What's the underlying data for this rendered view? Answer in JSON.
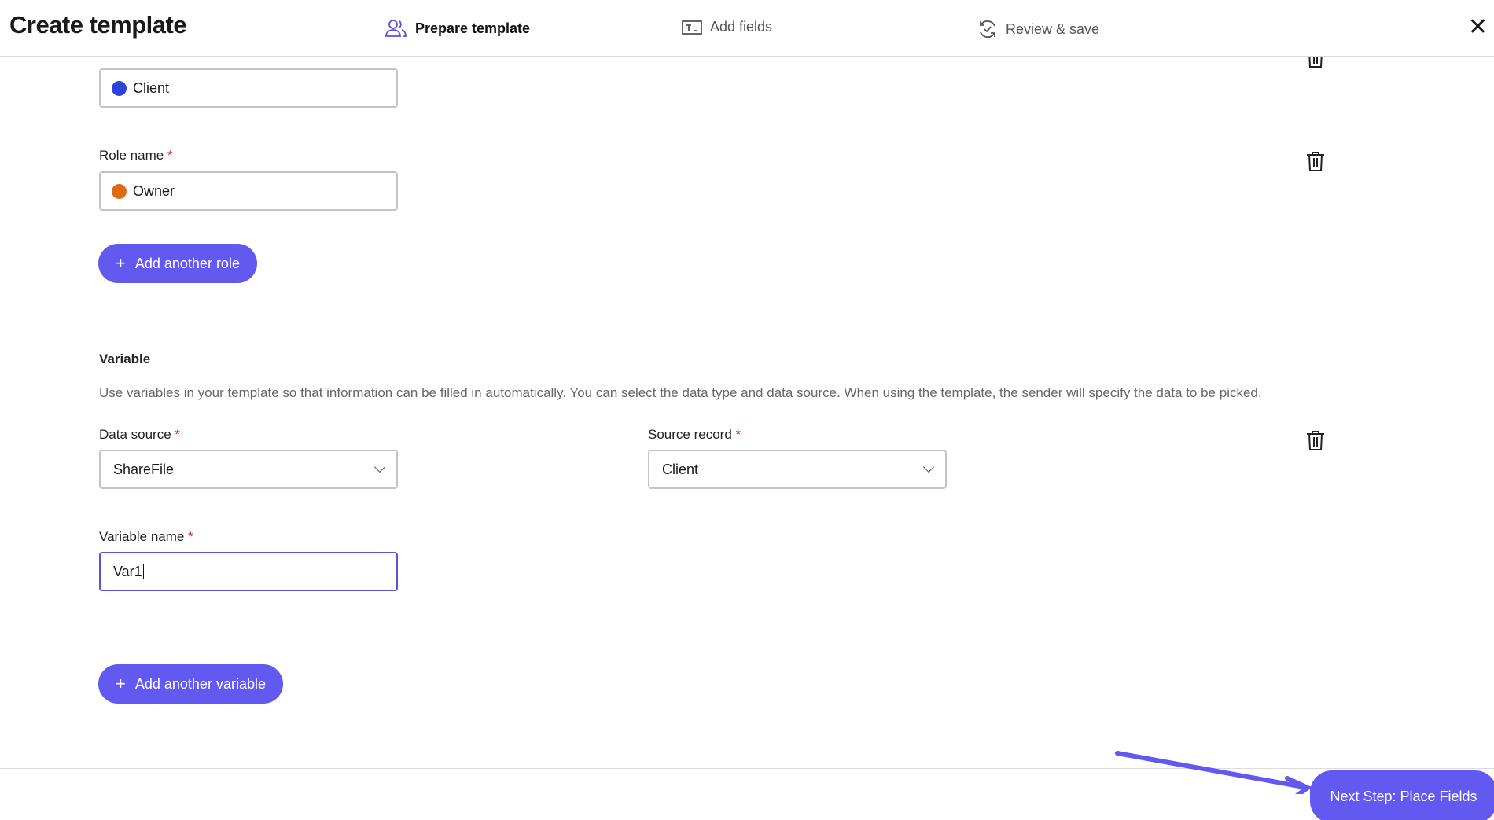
{
  "header": {
    "title": "Create template",
    "close_icon": "close-icon",
    "steps": [
      {
        "label": "Prepare template",
        "icon": "users-icon",
        "active": true
      },
      {
        "label": "Add fields",
        "icon": "text-field-icon",
        "active": false
      },
      {
        "label": "Review & save",
        "icon": "refresh-check-icon",
        "active": false
      }
    ]
  },
  "roles": {
    "items": [
      {
        "label": "Role name",
        "value": "Client",
        "color": "#2b45d8"
      },
      {
        "label": "Role name",
        "required": "*",
        "value": "Owner",
        "color": "#e06a10"
      }
    ],
    "add_label": "Add another role"
  },
  "variable": {
    "heading": "Variable",
    "description": "Use variables in your template so that information can be filled in automatically. You can select the data type and data source. When using the template, the sender will specify the data to be picked.",
    "data_source_label": "Data source",
    "data_source_value": "ShareFile",
    "source_record_label": "Source record",
    "source_record_value": "Client",
    "variable_name_label": "Variable name",
    "variable_name_value": "Var1",
    "required": "*",
    "add_label": "Add another variable"
  },
  "footer": {
    "next_label": "Next Step: Place Fields"
  },
  "colors": {
    "accent": "#6159f0",
    "required": "#d0232c"
  }
}
